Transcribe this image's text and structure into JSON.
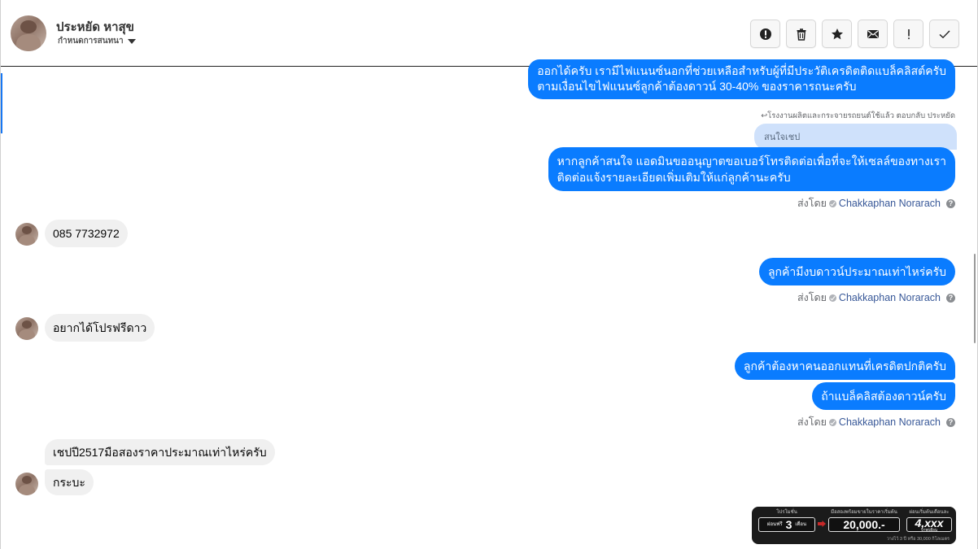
{
  "contact": {
    "name": "ประหยัด หาสุข",
    "status": "กำหนดการสนทนา"
  },
  "toolbar": {
    "buttons": [
      {
        "icon": "alert-circle-icon",
        "label": "Spam"
      },
      {
        "icon": "trash-icon",
        "label": "Delete"
      },
      {
        "icon": "star-icon",
        "label": "Star"
      },
      {
        "icon": "envelope-icon",
        "label": "Mark unread"
      },
      {
        "icon": "exclamation-icon",
        "label": "Follow up"
      },
      {
        "icon": "checkmark-icon",
        "label": "Done"
      }
    ]
  },
  "messages": {
    "m1": "ออกได้ครับ เรามีไฟแนนซ์นอกที่ช่วยเหลือสำหรับผู้ที่มีประวัติเครดิตติดแบล็คลิสต์ครับ\nตามเงื่อนไขไฟแนนซ์ลูกค้าต้องดาวน์ 30-40% ของราคารถนะครับ",
    "reply_note": "↩โรงงานผลิตและกระจายรถยนต์ใช้แล้ว ตอบกลับ ประหยัด",
    "quoted": "สนใจเชป",
    "m2": "หากลูกค้าสนใจ แอดมินขออนุญาตขอเบอร์โทรติดต่อเพื่อที่จะให้เซลล์ของทางเรา\nติดต่อแจ้งรายละเอียดเพิ่มเติมให้แก่ลูกค้านะครับ",
    "m3": "085 7732972",
    "m4": "ลูกค้ามีงบดาวน์ประมาณเท่าไหร่ครับ",
    "m5": "อยากได้โปรฟรีดาว",
    "m6": "ลูกค้าต้องหาคนออกแทนที่เครดิตปกติครับ",
    "m7": "ถ้าแบล็คลิสต้องดาวน์ครับ",
    "m8": "เชปปี2517มือสองราคาประมาณเท่าไหร่ครับ",
    "m9": "กระบะ"
  },
  "sent_by": {
    "prefix": "ส่งโดย",
    "agent": "Chakkaphan Norarach"
  },
  "promo_banner": {
    "cap1": "โปรโมชั่น",
    "pre1": "ผ่อนฟรี",
    "val1": "3",
    "unit1": "เดือน",
    "cap2": "มือสองพร้อมขายในราคาเริ่มต้น",
    "val2": "20,000.-",
    "cap3": "ผ่อนเริ่มต้นเดือนละ",
    "val3": "4,xxx",
    "unit3": "บาท/เดือน",
    "footnote": "วางไว้ 3 ปี หรือ 30,000 กิโลเมตร"
  }
}
